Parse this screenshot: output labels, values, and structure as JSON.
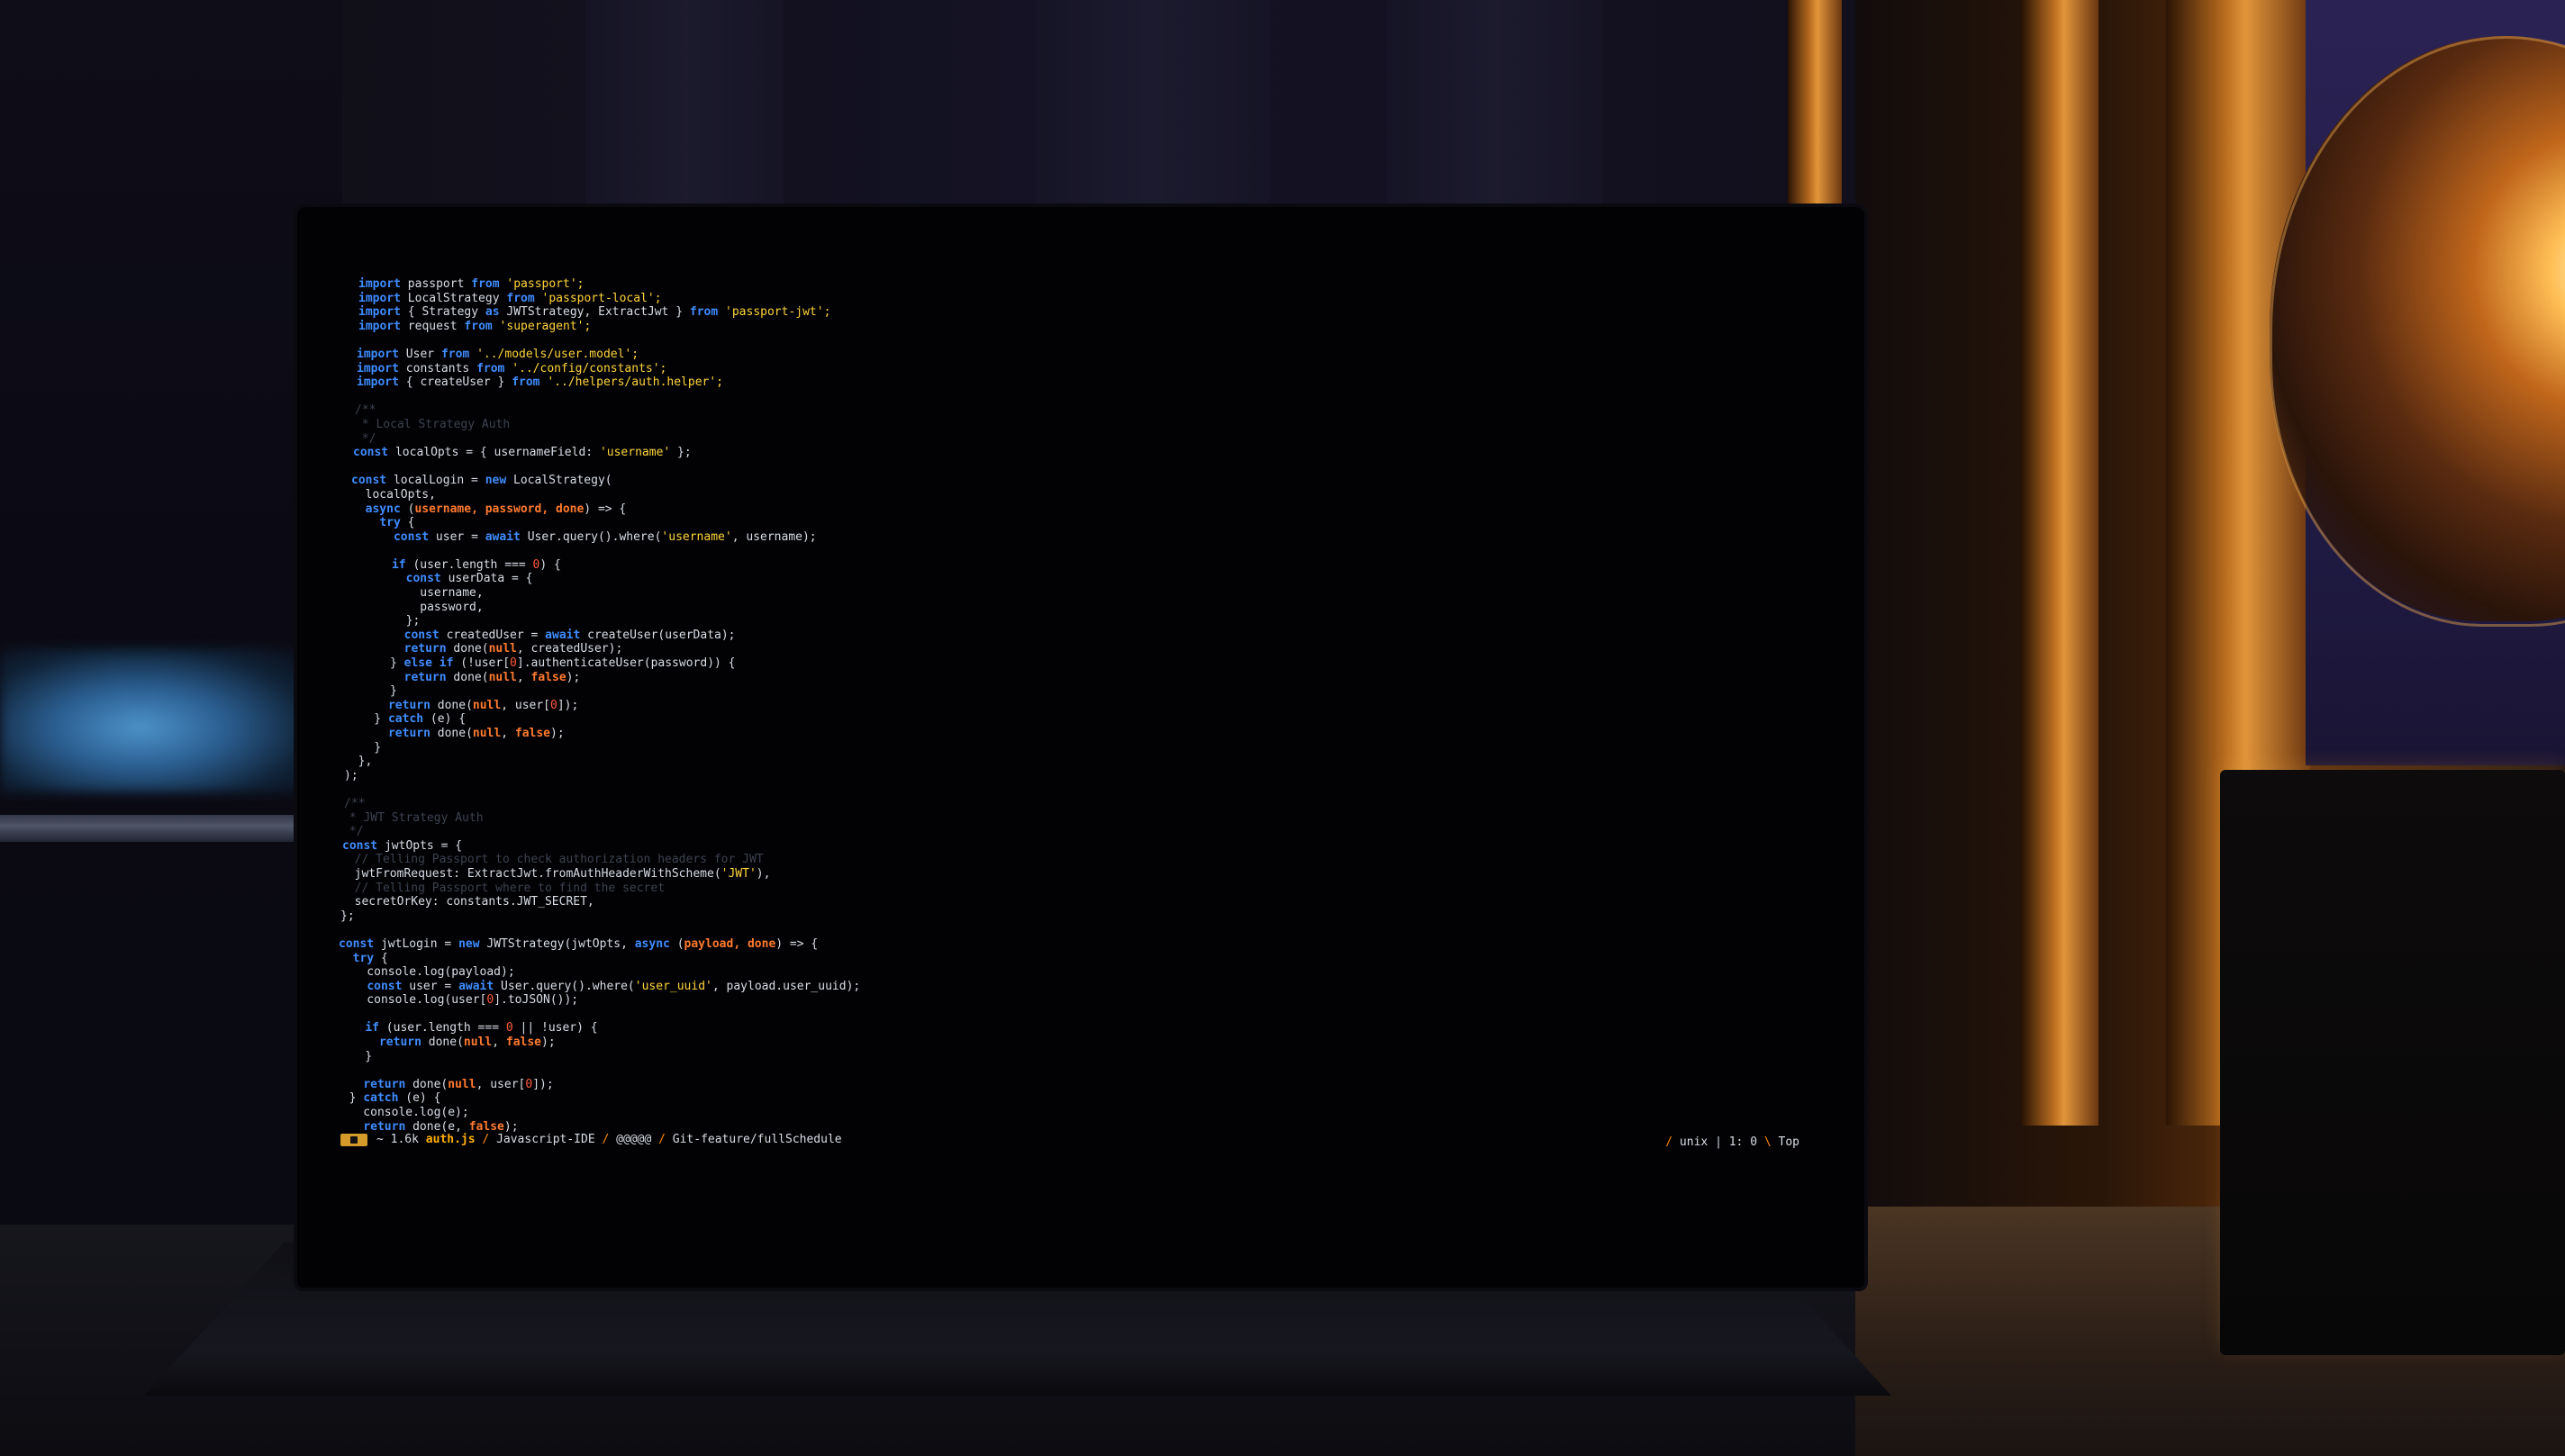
{
  "editor": {
    "lines": [
      [
        {
          "t": "import",
          "c": "kw"
        },
        {
          "t": " passport ",
          "c": "id"
        },
        {
          "t": "from",
          "c": "kw"
        },
        {
          "t": " 'passport';",
          "c": "str"
        }
      ],
      [
        {
          "t": "import",
          "c": "kw"
        },
        {
          "t": " LocalStrategy ",
          "c": "id"
        },
        {
          "t": "from",
          "c": "kw"
        },
        {
          "t": " 'passport-local';",
          "c": "str"
        }
      ],
      [
        {
          "t": "import",
          "c": "kw"
        },
        {
          "t": " { Strategy ",
          "c": "id"
        },
        {
          "t": "as",
          "c": "kw"
        },
        {
          "t": " JWTStrategy, ExtractJwt } ",
          "c": "id"
        },
        {
          "t": "from",
          "c": "kw"
        },
        {
          "t": " 'passport-jwt';",
          "c": "str"
        }
      ],
      [
        {
          "t": "import",
          "c": "kw"
        },
        {
          "t": " request ",
          "c": "id"
        },
        {
          "t": "from",
          "c": "kw"
        },
        {
          "t": " 'superagent';",
          "c": "str"
        }
      ],
      [],
      [
        {
          "t": "import",
          "c": "kw"
        },
        {
          "t": " User ",
          "c": "id"
        },
        {
          "t": "from",
          "c": "kw"
        },
        {
          "t": " '../models/user.model';",
          "c": "str"
        }
      ],
      [
        {
          "t": "import",
          "c": "kw"
        },
        {
          "t": " constants ",
          "c": "id"
        },
        {
          "t": "from",
          "c": "kw"
        },
        {
          "t": " '../config/constants';",
          "c": "str"
        }
      ],
      [
        {
          "t": "import",
          "c": "kw"
        },
        {
          "t": " { createUser } ",
          "c": "id"
        },
        {
          "t": "from",
          "c": "kw"
        },
        {
          "t": " '../helpers/auth.helper';",
          "c": "str"
        }
      ],
      [],
      [
        {
          "t": "/**",
          "c": "cmt"
        }
      ],
      [
        {
          "t": " * Local Strategy Auth",
          "c": "cmt"
        }
      ],
      [
        {
          "t": " */",
          "c": "cmt"
        }
      ],
      [
        {
          "t": "const",
          "c": "kw"
        },
        {
          "t": " localOpts = { usernameField: ",
          "c": "id"
        },
        {
          "t": "'username'",
          "c": "str"
        },
        {
          "t": " };",
          "c": "id"
        }
      ],
      [],
      [
        {
          "t": "const",
          "c": "kw"
        },
        {
          "t": " localLogin = ",
          "c": "id"
        },
        {
          "t": "new",
          "c": "kw"
        },
        {
          "t": " LocalStrategy(",
          "c": "id"
        }
      ],
      [
        {
          "t": "  localOpts,",
          "c": "id"
        }
      ],
      [
        {
          "t": "  ",
          "c": "id"
        },
        {
          "t": "async",
          "c": "kw"
        },
        {
          "t": " (",
          "c": "id"
        },
        {
          "t": "username, password, done",
          "c": "param"
        },
        {
          "t": ") => {",
          "c": "id"
        }
      ],
      [
        {
          "t": "    ",
          "c": "id"
        },
        {
          "t": "try",
          "c": "kw"
        },
        {
          "t": " {",
          "c": "id"
        }
      ],
      [
        {
          "t": "      ",
          "c": "id"
        },
        {
          "t": "const",
          "c": "kw"
        },
        {
          "t": " user = ",
          "c": "id"
        },
        {
          "t": "await",
          "c": "kw"
        },
        {
          "t": " User.query().where(",
          "c": "id"
        },
        {
          "t": "'username'",
          "c": "str"
        },
        {
          "t": ", username);",
          "c": "id"
        }
      ],
      [],
      [
        {
          "t": "      ",
          "c": "id"
        },
        {
          "t": "if",
          "c": "kw"
        },
        {
          "t": " (user.length === ",
          "c": "id"
        },
        {
          "t": "0",
          "c": "num"
        },
        {
          "t": ") {",
          "c": "id"
        }
      ],
      [
        {
          "t": "        ",
          "c": "id"
        },
        {
          "t": "const",
          "c": "kw"
        },
        {
          "t": " userData = {",
          "c": "id"
        }
      ],
      [
        {
          "t": "          username,",
          "c": "id"
        }
      ],
      [
        {
          "t": "          password,",
          "c": "id"
        }
      ],
      [
        {
          "t": "        };",
          "c": "id"
        }
      ],
      [
        {
          "t": "        ",
          "c": "id"
        },
        {
          "t": "const",
          "c": "kw"
        },
        {
          "t": " createdUser = ",
          "c": "id"
        },
        {
          "t": "await",
          "c": "kw"
        },
        {
          "t": " createUser(userData);",
          "c": "id"
        }
      ],
      [
        {
          "t": "        ",
          "c": "id"
        },
        {
          "t": "return",
          "c": "kw"
        },
        {
          "t": " done(",
          "c": "id"
        },
        {
          "t": "null",
          "c": "param"
        },
        {
          "t": ", createdUser);",
          "c": "id"
        }
      ],
      [
        {
          "t": "      } ",
          "c": "id"
        },
        {
          "t": "else if",
          "c": "kw"
        },
        {
          "t": " (!user[",
          "c": "id"
        },
        {
          "t": "0",
          "c": "num"
        },
        {
          "t": "].authenticateUser(password)) {",
          "c": "id"
        }
      ],
      [
        {
          "t": "        ",
          "c": "id"
        },
        {
          "t": "return",
          "c": "kw"
        },
        {
          "t": " done(",
          "c": "id"
        },
        {
          "t": "null",
          "c": "param"
        },
        {
          "t": ", ",
          "c": "id"
        },
        {
          "t": "false",
          "c": "param"
        },
        {
          "t": ");",
          "c": "id"
        }
      ],
      [
        {
          "t": "      }",
          "c": "id"
        }
      ],
      [
        {
          "t": "      ",
          "c": "id"
        },
        {
          "t": "return",
          "c": "kw"
        },
        {
          "t": " done(",
          "c": "id"
        },
        {
          "t": "null",
          "c": "param"
        },
        {
          "t": ", user[",
          "c": "id"
        },
        {
          "t": "0",
          "c": "num"
        },
        {
          "t": "]);",
          "c": "id"
        }
      ],
      [
        {
          "t": "    } ",
          "c": "id"
        },
        {
          "t": "catch",
          "c": "kw"
        },
        {
          "t": " (e) {",
          "c": "id"
        }
      ],
      [
        {
          "t": "      ",
          "c": "id"
        },
        {
          "t": "return",
          "c": "kw"
        },
        {
          "t": " done(",
          "c": "id"
        },
        {
          "t": "null",
          "c": "param"
        },
        {
          "t": ", ",
          "c": "id"
        },
        {
          "t": "false",
          "c": "param"
        },
        {
          "t": ");",
          "c": "id"
        }
      ],
      [
        {
          "t": "    }",
          "c": "id"
        }
      ],
      [
        {
          "t": "  },",
          "c": "id"
        }
      ],
      [
        {
          "t": ");",
          "c": "id"
        }
      ],
      [],
      [
        {
          "t": "/**",
          "c": "cmt"
        }
      ],
      [
        {
          "t": " * JWT Strategy Auth",
          "c": "cmt"
        }
      ],
      [
        {
          "t": " */",
          "c": "cmt"
        }
      ],
      [
        {
          "t": "const",
          "c": "kw"
        },
        {
          "t": " jwtOpts = {",
          "c": "id"
        }
      ],
      [
        {
          "t": "  // Telling Passport to check authorization headers for JWT",
          "c": "cmt"
        }
      ],
      [
        {
          "t": "  jwtFromRequest: ExtractJwt.fromAuthHeaderWithScheme(",
          "c": "id"
        },
        {
          "t": "'JWT'",
          "c": "str"
        },
        {
          "t": "),",
          "c": "id"
        }
      ],
      [
        {
          "t": "  // Telling Passport where to find the secret",
          "c": "cmt"
        }
      ],
      [
        {
          "t": "  secretOrKey: constants.JWT_SECRET,",
          "c": "id"
        }
      ],
      [
        {
          "t": "};",
          "c": "id"
        }
      ],
      [],
      [
        {
          "t": "const",
          "c": "kw"
        },
        {
          "t": " jwtLogin = ",
          "c": "id"
        },
        {
          "t": "new",
          "c": "kw"
        },
        {
          "t": " JWTStrategy(jwtOpts, ",
          "c": "id"
        },
        {
          "t": "async",
          "c": "kw"
        },
        {
          "t": " (",
          "c": "id"
        },
        {
          "t": "payload, done",
          "c": "param"
        },
        {
          "t": ") => {",
          "c": "id"
        }
      ],
      [
        {
          "t": "  ",
          "c": "id"
        },
        {
          "t": "try",
          "c": "kw"
        },
        {
          "t": " {",
          "c": "id"
        }
      ],
      [
        {
          "t": "    console.log(payload);",
          "c": "id"
        }
      ],
      [
        {
          "t": "    ",
          "c": "id"
        },
        {
          "t": "const",
          "c": "kw"
        },
        {
          "t": " user = ",
          "c": "id"
        },
        {
          "t": "await",
          "c": "kw"
        },
        {
          "t": " User.query().where(",
          "c": "id"
        },
        {
          "t": "'user_uuid'",
          "c": "str"
        },
        {
          "t": ", payload.user_uuid);",
          "c": "id"
        }
      ],
      [
        {
          "t": "    console.log(user[",
          "c": "id"
        },
        {
          "t": "0",
          "c": "num"
        },
        {
          "t": "].toJSON());",
          "c": "id"
        }
      ],
      [],
      [
        {
          "t": "    ",
          "c": "id"
        },
        {
          "t": "if",
          "c": "kw"
        },
        {
          "t": " (user.length === ",
          "c": "id"
        },
        {
          "t": "0",
          "c": "num"
        },
        {
          "t": " || !user) {",
          "c": "id"
        }
      ],
      [
        {
          "t": "      ",
          "c": "id"
        },
        {
          "t": "return",
          "c": "kw"
        },
        {
          "t": " done(",
          "c": "id"
        },
        {
          "t": "null",
          "c": "param"
        },
        {
          "t": ", ",
          "c": "id"
        },
        {
          "t": "false",
          "c": "param"
        },
        {
          "t": ");",
          "c": "id"
        }
      ],
      [
        {
          "t": "    }",
          "c": "id"
        }
      ],
      [],
      [
        {
          "t": "    ",
          "c": "id"
        },
        {
          "t": "return",
          "c": "kw"
        },
        {
          "t": " done(",
          "c": "id"
        },
        {
          "t": "null",
          "c": "param"
        },
        {
          "t": ", user[",
          "c": "id"
        },
        {
          "t": "0",
          "c": "num"
        },
        {
          "t": "]);",
          "c": "id"
        }
      ],
      [
        {
          "t": "  } ",
          "c": "id"
        },
        {
          "t": "catch",
          "c": "kw"
        },
        {
          "t": " (e) {",
          "c": "id"
        }
      ],
      [
        {
          "t": "    console.log(e);",
          "c": "id"
        }
      ],
      [
        {
          "t": "    ",
          "c": "id"
        },
        {
          "t": "return",
          "c": "kw"
        },
        {
          "t": " done(e, ",
          "c": "id"
        },
        {
          "t": "false",
          "c": "param"
        },
        {
          "t": ");",
          "c": "id"
        }
      ]
    ]
  },
  "statusbar": {
    "size": "~ 1.6k",
    "file": "auth.js",
    "project": "Javascript-IDE",
    "indicators": "@@@@@",
    "branch": "Git-feature/fullSchedule",
    "format": "unix",
    "position": "1: 0",
    "scroll": "Top"
  },
  "colors": {
    "keyword": "#3f8cff",
    "string": "#ffd43b",
    "param": "#ff7a2f",
    "number": "#ff5a3c",
    "comment": "#3c4250",
    "badge": "#d49a2a"
  }
}
